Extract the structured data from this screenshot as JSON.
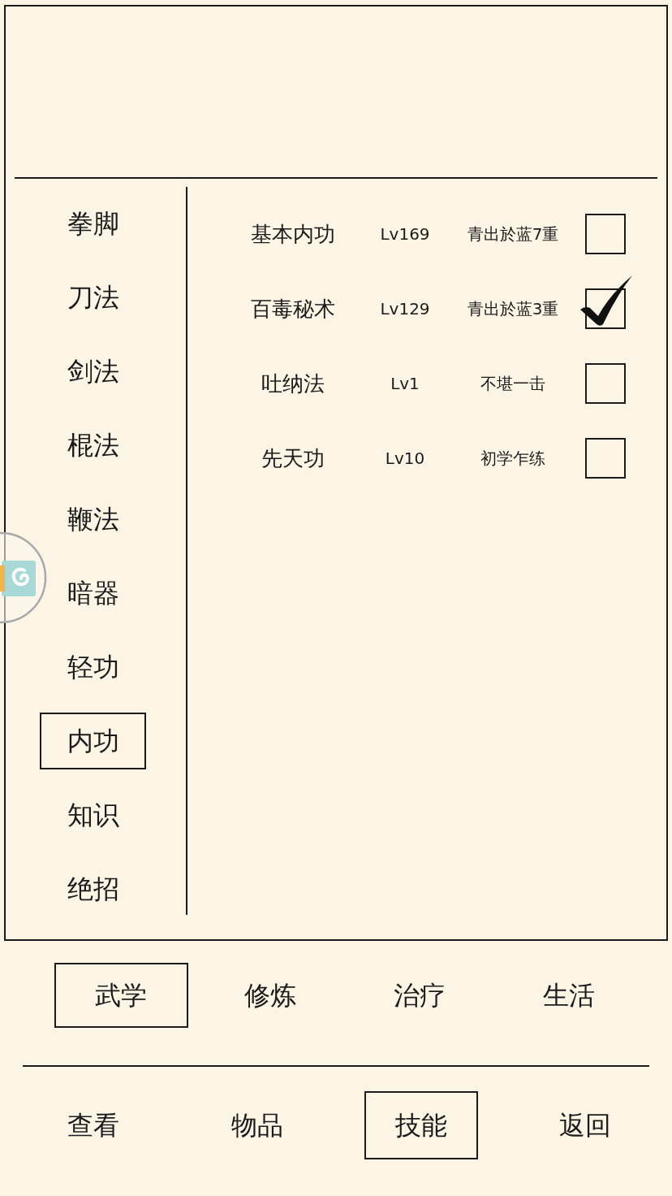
{
  "sidebar": {
    "items": [
      {
        "label": "拳脚",
        "selected": false
      },
      {
        "label": "刀法",
        "selected": false
      },
      {
        "label": "剑法",
        "selected": false
      },
      {
        "label": "棍法",
        "selected": false
      },
      {
        "label": "鞭法",
        "selected": false
      },
      {
        "label": "暗器",
        "selected": false
      },
      {
        "label": "轻功",
        "selected": false
      },
      {
        "label": "内功",
        "selected": true
      },
      {
        "label": "知识",
        "selected": false
      },
      {
        "label": "绝招",
        "selected": false
      }
    ]
  },
  "skills": [
    {
      "name": "基本内功",
      "level": "Lv169",
      "rank": "青出於蓝7重",
      "checked": false
    },
    {
      "name": "百毒秘术",
      "level": "Lv129",
      "rank": "青出於蓝3重",
      "checked": true
    },
    {
      "name": "吐纳法",
      "level": "Lv1",
      "rank": "不堪一击",
      "checked": false
    },
    {
      "name": "先天功",
      "level": "Lv10",
      "rank": "初学乍练",
      "checked": false
    }
  ],
  "category_tabs": [
    {
      "label": "武学",
      "selected": true
    },
    {
      "label": "修炼",
      "selected": false
    },
    {
      "label": "治疗",
      "selected": false
    },
    {
      "label": "生活",
      "selected": false
    }
  ],
  "bottom_nav": [
    {
      "label": "查看",
      "selected": false
    },
    {
      "label": "物品",
      "selected": false
    },
    {
      "label": "技能",
      "selected": true
    },
    {
      "label": "返回",
      "selected": false
    }
  ]
}
